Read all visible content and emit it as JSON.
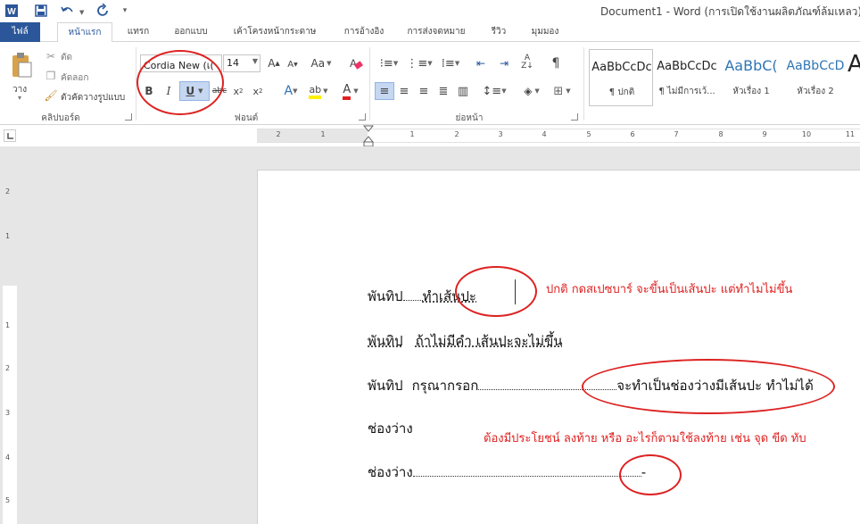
{
  "window": {
    "title": "Document1 - Word (การเปิดใช้งานผลิตภัณฑ์ล้มเหลว)"
  },
  "tabs": [
    "ไฟล์",
    "หน้าแรก",
    "แทรก",
    "ออกแบบ",
    "เค้าโครงหน้ากระดาษ",
    "การอ้างอิง",
    "การส่งจดหมาย",
    "รีวิว",
    "มุมมอง"
  ],
  "ribbon": {
    "clipboard": {
      "paste": "วาง",
      "cut": "ตัด",
      "copy": "คัดลอก",
      "format_painter": "ตัวคัดวางรูปแบบ",
      "label": "คลิปบอร์ด"
    },
    "font": {
      "name": "Cordia New (เ(",
      "size": "14",
      "label": "ฟอนต์",
      "change_case": "Aa"
    },
    "paragraph": {
      "label": "ย่อหน้า"
    },
    "styles": [
      {
        "sample": "AaBbCcDc",
        "name": "¶ ปกติ",
        "color": "#222222"
      },
      {
        "sample": "AaBbCcDc",
        "name": "¶ ไม่มีการเว้...",
        "color": "#222222"
      },
      {
        "sample": "AaBbC(",
        "name": "หัวเรื่อง 1",
        "color": "#2e74b5"
      },
      {
        "sample": "AaBbCcD",
        "name": "หัวเรื่อง 2",
        "color": "#2e74b5"
      },
      {
        "sample": "A",
        "name": "",
        "color": "#222222"
      }
    ]
  },
  "ruler": {
    "h_numbers": [
      "2",
      "1",
      "1",
      "2",
      "3",
      "4",
      "5",
      "6",
      "7",
      "8",
      "9",
      "10",
      "11"
    ],
    "v_numbers": [
      "2",
      "1",
      "1",
      "2",
      "3",
      "4",
      "5"
    ]
  },
  "document": {
    "lines": [
      {
        "label": "พันทิป",
        "text": "ทำเส้นปะ"
      },
      {
        "label": "พันทิป",
        "text": "ถ้าไม่มีคำ เส้นปะจะไม่ขึ้น"
      },
      {
        "label": "พันทิป",
        "text": "กรุณากรอก",
        "trail": "จะทำเป็นช่องว่างมีเส้นปะ ทำไม่ได้"
      },
      {
        "label": "ช่องว่าง"
      },
      {
        "label": "ช่องว่าง",
        "trail": "-"
      }
    ],
    "annotations": {
      "a1": "ปกติ กดสเปซบาร์ จะขึ้นเป็นเส้นปะ แต่ทำไมไม่ขึ้น",
      "a2": "ต้องมีประโยชน์ ลงท้าย หรือ อะไรก็ตามใช้ลงท้าย เช่น จุด ขีด ทับ"
    }
  },
  "colors": {
    "accent": "#2b579a",
    "annotation": "#e02020"
  }
}
